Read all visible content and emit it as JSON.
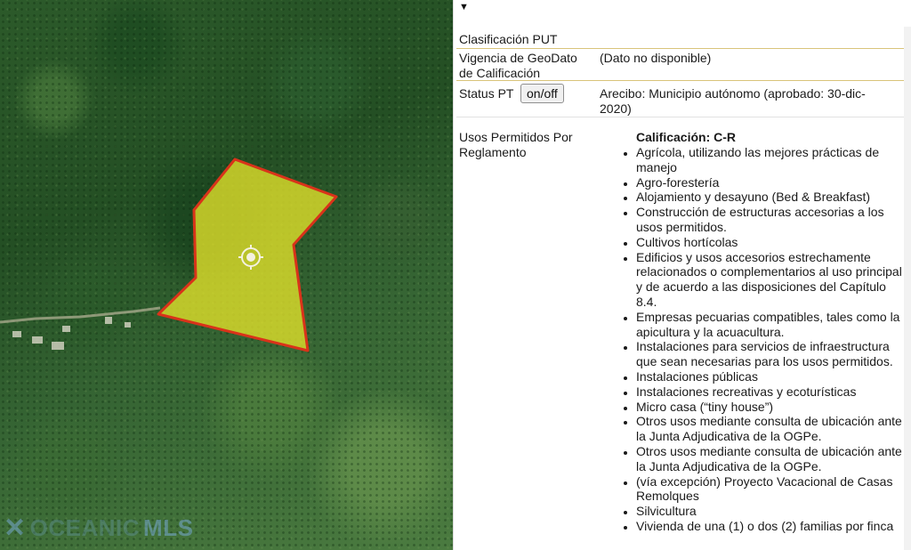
{
  "map": {
    "watermark_text": "OCEANIC",
    "watermark_brand": "MLS",
    "parcel_fill": "#e0e02a",
    "parcel_stroke": "#d9331a"
  },
  "panel": {
    "rows": [
      {
        "label": "Clasificación PUT",
        "value": ""
      },
      {
        "label": "Vigencia de GeoDato de Calificación",
        "value": "(Dato no disponible)"
      },
      {
        "label": "Status PT",
        "button": "on/off",
        "value": "Arecibo: Municipio autónomo (aprobado: 30-dic-2020)"
      },
      {
        "label": "Usos Permitidos Por Reglamento"
      }
    ],
    "calificacion_title": "Calificación: C-R",
    "usos": [
      "Agrícola, utilizando las mejores prácticas de manejo",
      "Agro-forestería",
      "Alojamiento y desayuno (Bed & Breakfast)",
      "Construcción de estructuras accesorias a los usos permitidos.",
      "Cultivos hortícolas",
      "Edificios y usos accesorios estrechamente relacionados o complementarios al uso principal y de acuerdo a las disposiciones del Capítulo 8.4.",
      "Empresas pecuarias compatibles, tales como la apicultura y la acuacultura.",
      "Instalaciones para servicios de infraestructura que sean necesarias para los usos permitidos.",
      "Instalaciones públicas",
      "Instalaciones recreativas y ecoturísticas",
      "Micro casa (“tiny house”)",
      "Otros usos mediante consulta de ubicación ante la Junta Adjudicativa de la OGPe.",
      "Otros usos mediante consulta de ubicación ante la Junta Adjudicativa de la OGPe.",
      "(vía excepción) Proyecto Vacacional de Casas Remolques",
      "Silvicultura",
      "Vivienda de una (1) o dos (2) familias por finca"
    ]
  }
}
